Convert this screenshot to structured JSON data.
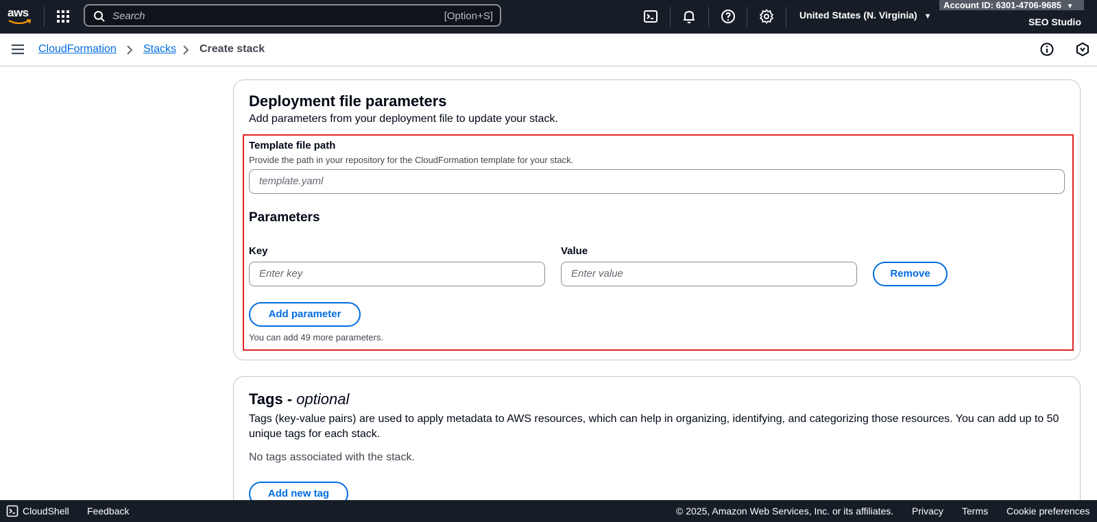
{
  "topnav": {
    "logo_text": "aws",
    "search_placeholder": "Search",
    "search_shortcut": "[Option+S]",
    "region": "United States (N. Virginia)",
    "account": "Account ID: 6301-4706-9685",
    "user": "SEO Studio"
  },
  "breadcrumb": {
    "items": [
      "CloudFormation",
      "Stacks"
    ],
    "current": "Create stack"
  },
  "deployment": {
    "title": "Deployment file parameters",
    "description": "Add parameters from your deployment file to update your stack.",
    "template_label": "Template file path",
    "template_desc": "Provide the path in your repository for the CloudFormation template for your stack.",
    "template_placeholder": "template.yaml",
    "params_title": "Parameters",
    "key_label": "Key",
    "key_placeholder": "Enter key",
    "value_label": "Value",
    "value_placeholder": "Enter value",
    "remove_label": "Remove",
    "add_param_label": "Add parameter",
    "limit_hint": "You can add 49 more parameters."
  },
  "tags": {
    "title_main": "Tags - ",
    "title_optional": "optional",
    "description_line1": "Tags (key-value pairs) are used to apply metadata to AWS resources, which can help in organizing, identifying, and categorizing those resources. You can add up to 50",
    "description_line2": "unique tags for each stack.",
    "empty_text": "No tags associated with the stack.",
    "add_label": "Add new tag"
  },
  "footer": {
    "cloudshell": "CloudShell",
    "feedback": "Feedback",
    "copyright": "© 2025, Amazon Web Services, Inc. or its affiliates.",
    "privacy": "Privacy",
    "terms": "Terms",
    "cookies": "Cookie preferences"
  },
  "colors": {
    "nav_bg": "#161d26",
    "link": "#006ce0",
    "highlight_border": "#e02121"
  },
  "icons": [
    "aws-logo",
    "apps-grid-icon",
    "search-icon",
    "cloudshell-icon",
    "bell-icon",
    "help-icon",
    "gear-icon",
    "caret-down-icon",
    "menu-icon",
    "chevron-right-icon",
    "info-icon",
    "hexagon-icon"
  ]
}
